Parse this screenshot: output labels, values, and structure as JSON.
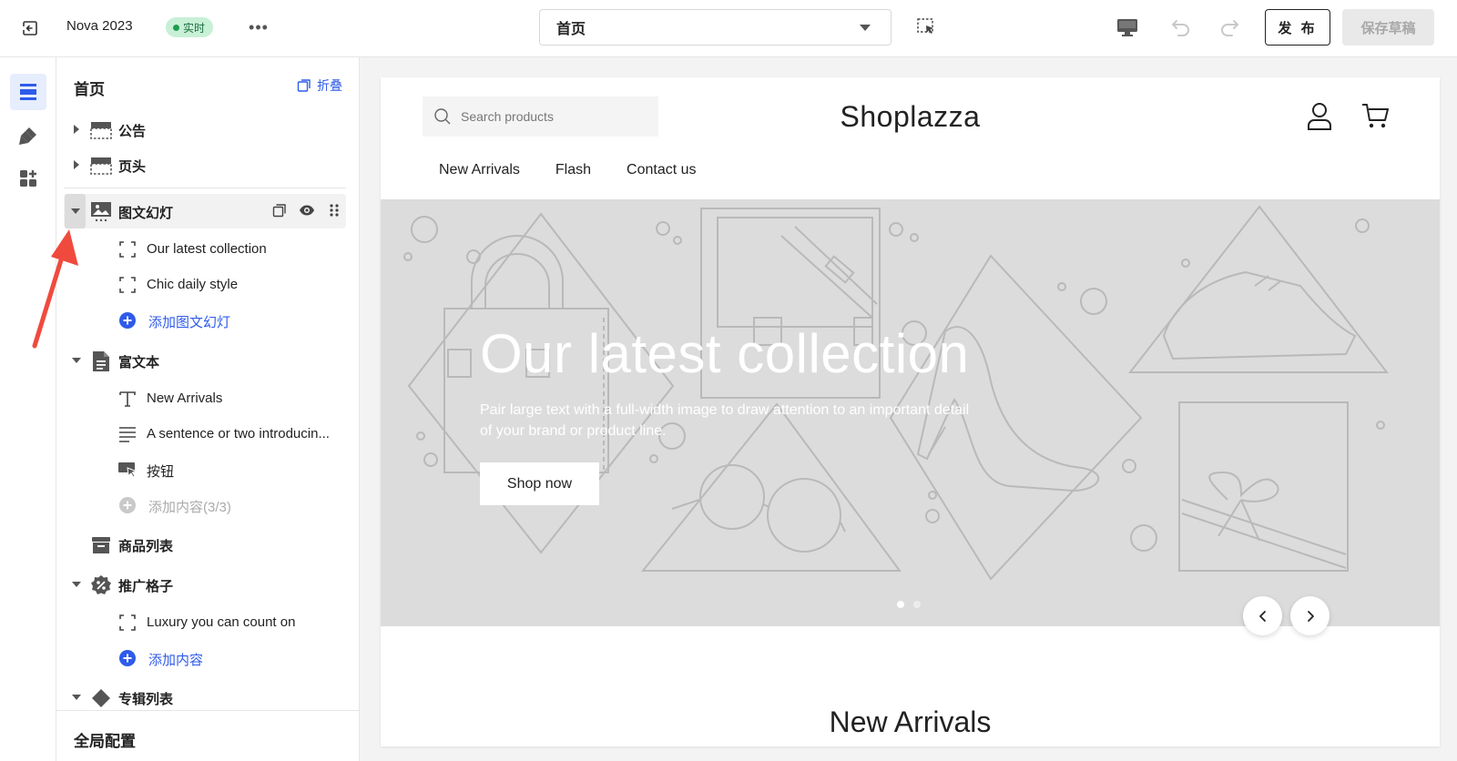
{
  "topbar": {
    "theme_name": "Nova 2023",
    "live_badge": "实时",
    "page_select": "首页",
    "publish": "发 布",
    "save_draft": "保存草稿"
  },
  "sidebar": {
    "title": "首页",
    "collapse": "折叠",
    "sections": [
      {
        "label": "公告",
        "expanded": false,
        "icon": "announcement-icon"
      },
      {
        "label": "页头",
        "expanded": false,
        "icon": "header-icon"
      },
      {
        "label": "图文幻灯",
        "expanded": true,
        "icon": "slideshow-icon",
        "selected": true,
        "blocks": [
          "Our latest collection",
          "Chic daily style"
        ],
        "add_label": "添加图文幻灯"
      },
      {
        "label": "富文本",
        "expanded": true,
        "icon": "rich-text-icon",
        "blocks": [
          "New Arrivals",
          "A sentence or two introducin...",
          "按钮"
        ],
        "add_label": "添加内容(3/3)"
      },
      {
        "label": "商品列表",
        "icon": "product-list-icon"
      },
      {
        "label": "推广格子",
        "expanded": true,
        "icon": "promo-grid-icon",
        "blocks": [
          "Luxury you can count on"
        ],
        "add_label": "添加内容"
      },
      {
        "label": "专辑列表",
        "icon": "collection-list-icon"
      }
    ],
    "global_config": "全局配置"
  },
  "preview": {
    "search_placeholder": "Search products",
    "logo": "Shoplazza",
    "nav": [
      "New Arrivals",
      "Flash",
      "Contact us"
    ],
    "hero": {
      "title": "Our latest collection",
      "description": "Pair large text with a full-width image to draw attention to an important detail of your brand or product line.",
      "button": "Shop now",
      "slide_count": 2,
      "active_slide": 1
    },
    "next_section_title": "New Arrivals"
  },
  "colors": {
    "accent": "#2f5bea",
    "live_badge_bg": "#c8f0d7",
    "annotation_arrow": "#f04a3e",
    "hero_bg": "#dcdcdc"
  }
}
